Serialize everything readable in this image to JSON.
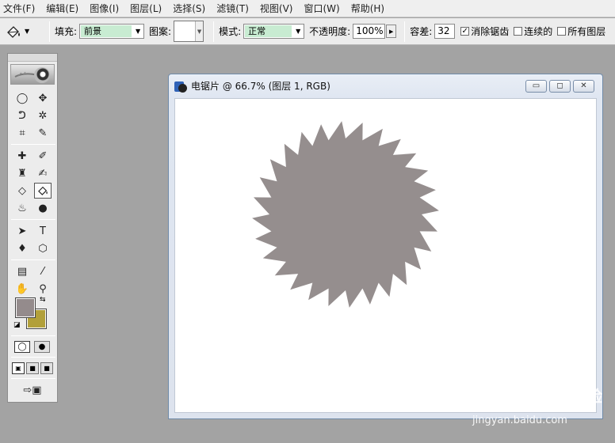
{
  "menu": [
    "文件(F)",
    "编辑(E)",
    "图像(I)",
    "图层(L)",
    "选择(S)",
    "滤镜(T)",
    "视图(V)",
    "窗口(W)",
    "帮助(H)"
  ],
  "options": {
    "fill_label": "填充:",
    "fill_value": "前景",
    "pattern_label": "图案:",
    "mode_label": "模式:",
    "mode_value": "正常",
    "opacity_label": "不透明度:",
    "opacity_value": "100%",
    "tolerance_label": "容差:",
    "tolerance_value": "32",
    "antialias_label": "消除锯齿",
    "antialias_checked": true,
    "contiguous_label": "连续的",
    "contiguous_checked": false,
    "all_layers_label": "所有图层",
    "all_layers_checked": false
  },
  "toolbox": {
    "foreground_color": "#948b8c",
    "background_color": "#b2a03a",
    "active_tool": "paint-bucket"
  },
  "document": {
    "title": "电锯片 @ 66.7% (图层 1, RGB)",
    "canvas_color": "#ffffff",
    "shape_fill": "#958e8e"
  },
  "watermark": {
    "logo": "Bai du 经验",
    "text": "jingyan.baidu.com"
  }
}
